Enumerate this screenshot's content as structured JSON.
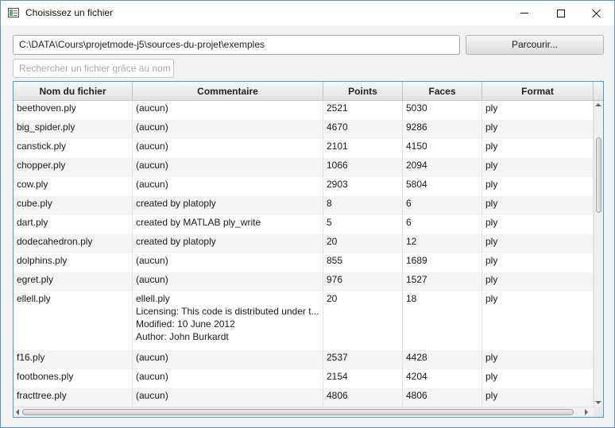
{
  "window": {
    "title": "Choisissez un fichier",
    "accent_color": "#3c9fd8"
  },
  "toolbar": {
    "path_value": "C:\\DATA\\Cours\\projetmode-j5\\sources-du-projet\\exemples",
    "browse_label": "Parcourir...",
    "search_placeholder": "Rechercher un fichier grâce au nom"
  },
  "table": {
    "columns": [
      "Nom du fichier",
      "Commentaire",
      "Points",
      "Faces",
      "Format"
    ],
    "rows": [
      {
        "name": "beethoven.ply",
        "comment": [
          "(aucun)"
        ],
        "points": "2521",
        "faces": "5030",
        "format": "ply"
      },
      {
        "name": "big_spider.ply",
        "comment": [
          "(aucun)"
        ],
        "points": "4670",
        "faces": "9286",
        "format": "ply"
      },
      {
        "name": "canstick.ply",
        "comment": [
          "(aucun)"
        ],
        "points": "2101",
        "faces": "4150",
        "format": "ply"
      },
      {
        "name": "chopper.ply",
        "comment": [
          "(aucun)"
        ],
        "points": "1066",
        "faces": "2094",
        "format": "ply"
      },
      {
        "name": "cow.ply",
        "comment": [
          "(aucun)"
        ],
        "points": "2903",
        "faces": "5804",
        "format": "ply"
      },
      {
        "name": "cube.ply",
        "comment": [
          "created by platoply"
        ],
        "points": "8",
        "faces": "6",
        "format": "ply"
      },
      {
        "name": "dart.ply",
        "comment": [
          "created by MATLAB ply_write"
        ],
        "points": "5",
        "faces": "6",
        "format": "ply"
      },
      {
        "name": "dodecahedron.ply",
        "comment": [
          "created by platoply"
        ],
        "points": "20",
        "faces": "12",
        "format": "ply"
      },
      {
        "name": "dolphins.ply",
        "comment": [
          "(aucun)"
        ],
        "points": "855",
        "faces": "1689",
        "format": "ply"
      },
      {
        "name": "egret.ply",
        "comment": [
          "(aucun)"
        ],
        "points": "976",
        "faces": "1527",
        "format": "ply"
      },
      {
        "name": "ellell.ply",
        "comment": [
          "ellell.ply",
          "Licensing: This code is distributed under t...",
          "Modified: 10 June 2012",
          "Author: John Burkardt"
        ],
        "points": "20",
        "faces": "18",
        "format": "ply"
      },
      {
        "name": "f16.ply",
        "comment": [
          "(aucun)"
        ],
        "points": "2537",
        "faces": "4428",
        "format": "ply"
      },
      {
        "name": "footbones.ply",
        "comment": [
          "(aucun)"
        ],
        "points": "2154",
        "faces": "4204",
        "format": "ply"
      },
      {
        "name": "fracttree.ply",
        "comment": [
          "(aucun)"
        ],
        "points": "4806",
        "faces": "4806",
        "format": "ply"
      }
    ]
  }
}
